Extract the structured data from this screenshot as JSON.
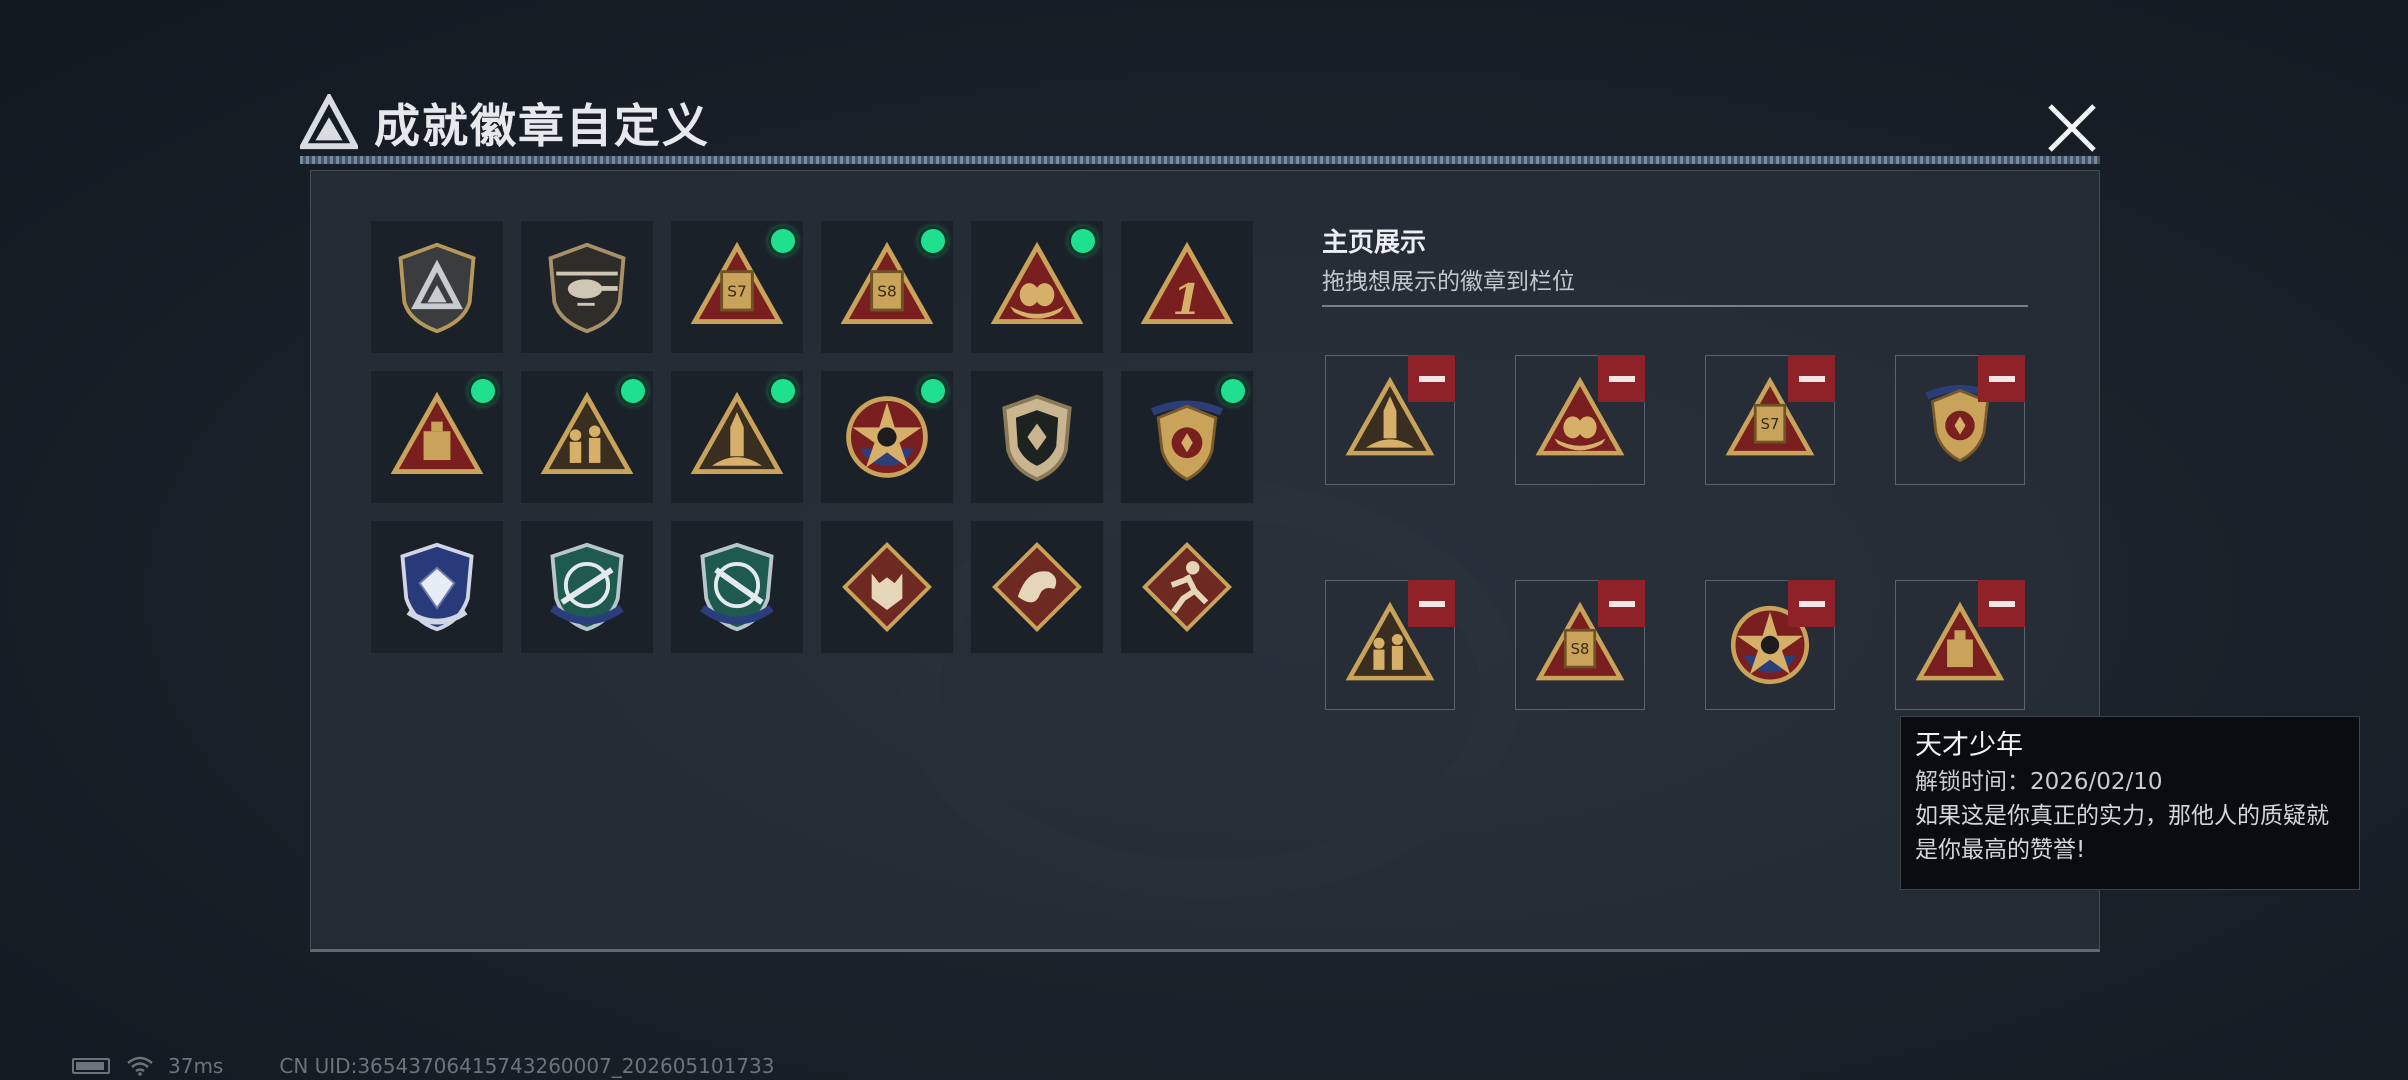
{
  "header": {
    "title": "成就徽章自定义",
    "logo_icon": "triangle-logo-icon",
    "close_icon": "close-icon"
  },
  "grid": {
    "badges": [
      {
        "id": "shield-logo",
        "new": false
      },
      {
        "id": "helicopter",
        "new": false
      },
      {
        "id": "s7-triangle",
        "new": true
      },
      {
        "id": "s8-triangle",
        "new": true
      },
      {
        "id": "nest-triangle",
        "new": true
      },
      {
        "id": "number-1-triangle",
        "new": false
      },
      {
        "id": "crate-triangle",
        "new": true
      },
      {
        "id": "soldiers-triangle",
        "new": true
      },
      {
        "id": "rocket-triangle",
        "new": true
      },
      {
        "id": "star-medal",
        "new": true
      },
      {
        "id": "emblem-shield",
        "new": false
      },
      {
        "id": "laurel-shield",
        "new": true
      },
      {
        "id": "diamond-shield",
        "new": false
      },
      {
        "id": "rifle-shield-a",
        "new": false
      },
      {
        "id": "rifle-shield-b",
        "new": false
      },
      {
        "id": "wolf-diamond",
        "new": false
      },
      {
        "id": "dragon-diamond",
        "new": false
      },
      {
        "id": "runner-diamond",
        "new": false
      }
    ]
  },
  "showcase": {
    "title": "主页展示",
    "subtitle": "拖拽想展示的徽章到栏位",
    "slots": [
      "rocket-triangle",
      "nest-triangle",
      "s7-triangle",
      "laurel-shield",
      "soldiers-triangle",
      "s8-triangle",
      "star-medal",
      "crate-triangle"
    ]
  },
  "tooltip": {
    "name": "天才少年",
    "time": "解锁时间：2026/02/10",
    "desc": "如果这是你真正的实力，那他人的质疑就是你最高的赞誉!"
  },
  "status": {
    "ping": "37ms",
    "uid": "CN UID:36543706415743260007_202605101733"
  },
  "colors": {
    "new_dot": "#1fe08e",
    "remove": "#8e2228",
    "gold": "#c9a35a",
    "red": "#7a1f1f"
  }
}
